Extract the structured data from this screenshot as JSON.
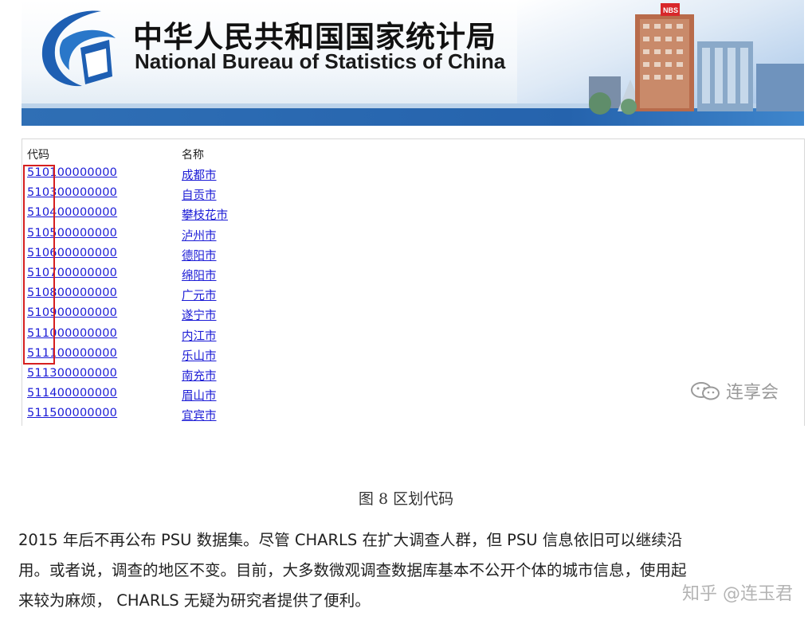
{
  "banner": {
    "title_cn": "中华人民共和国国家统计局",
    "title_en": "National Bureau of Statistics of China",
    "building_sign": "NBS",
    "colors": {
      "accent_blue": "#2563ad",
      "logo_blue": "#1e5fb3"
    }
  },
  "table": {
    "headers": {
      "code": "代码",
      "name": "名称"
    },
    "rows": [
      {
        "code": "510100000000",
        "name": "成都市"
      },
      {
        "code": "510300000000",
        "name": "自贡市"
      },
      {
        "code": "510400000000",
        "name": "攀枝花市"
      },
      {
        "code": "510500000000",
        "name": "泸州市"
      },
      {
        "code": "510600000000",
        "name": "德阳市"
      },
      {
        "code": "510700000000",
        "name": "绵阳市"
      },
      {
        "code": "510800000000",
        "name": "广元市"
      },
      {
        "code": "510900000000",
        "name": "遂宁市"
      },
      {
        "code": "511000000000",
        "name": "内江市"
      },
      {
        "code": "511100000000",
        "name": "乐山市"
      },
      {
        "code": "511300000000",
        "name": "南充市"
      },
      {
        "code": "511400000000",
        "name": "眉山市"
      },
      {
        "code": "511500000000",
        "name": "宜宾市"
      }
    ],
    "link_color": "#1b1bd6",
    "highlight_color": "#d61f1f"
  },
  "watermark_wechat": "连享会",
  "caption": "图 8 区划代码",
  "paragraph": [
    "2015 年后不再公布 PSU 数据集。尽管 CHARLS 在扩大调查人群，但  PSU 信息依旧可以继续沿",
    "用。或者说，调查的地区不变。目前，大多数微观调查数据库基本不公开个体的城市信息，使用起",
    "来较为麻烦，  CHARLS 无疑为研究者提供了便利。"
  ],
  "watermark_zhihu": "知乎 @连玉君"
}
